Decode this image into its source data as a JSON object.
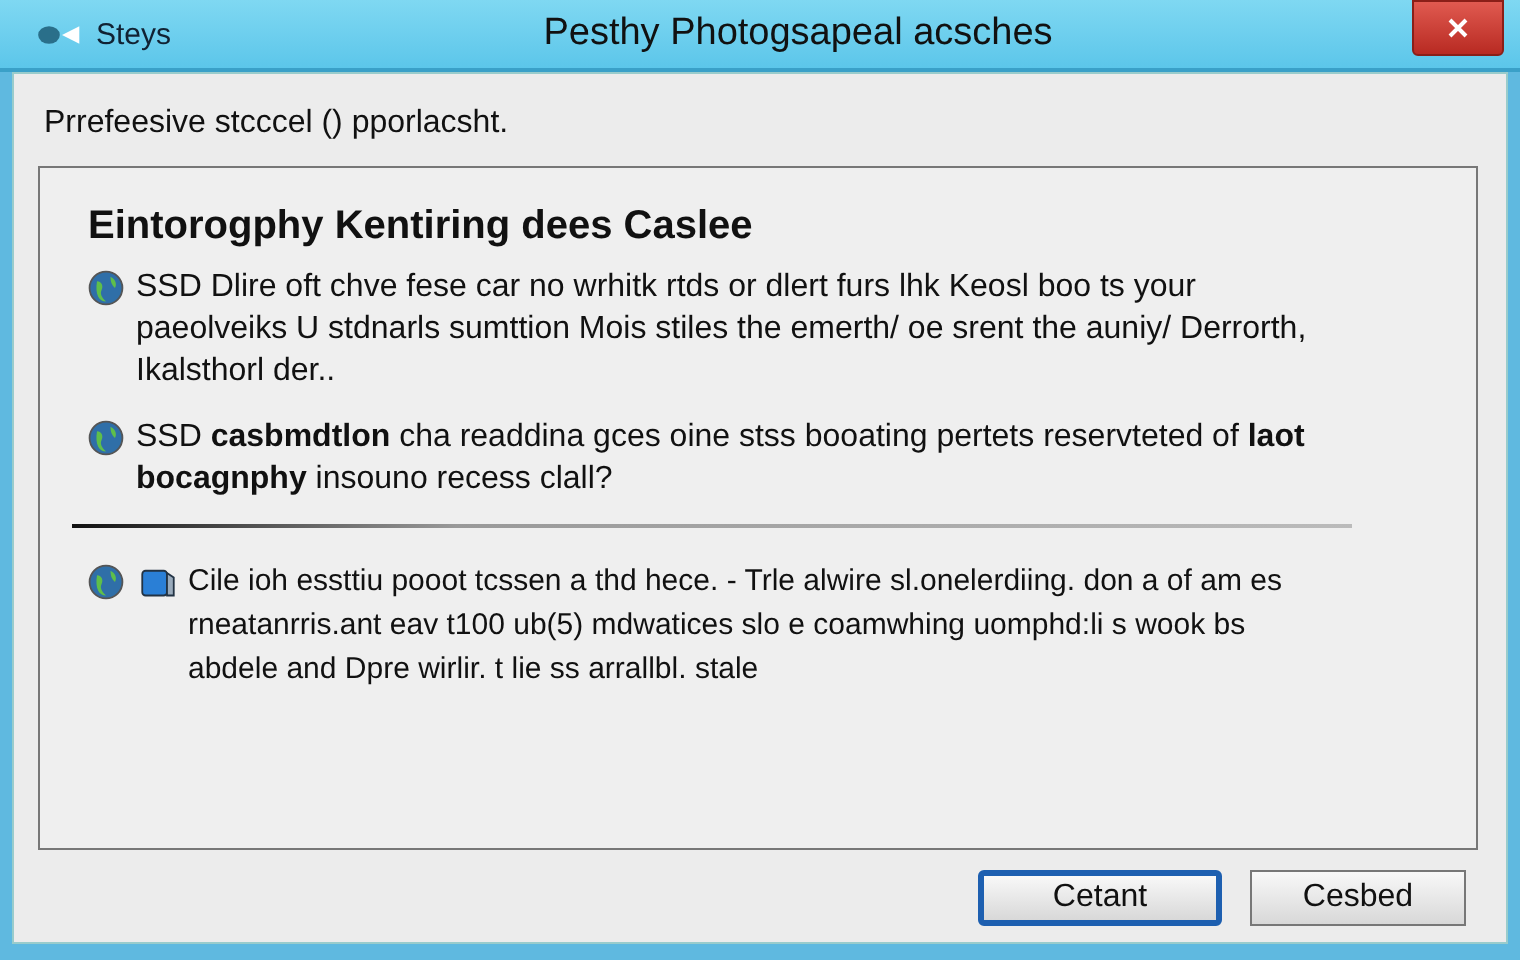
{
  "window": {
    "app_label": "Steys",
    "title": "Pesthy Photogsapeal acsches"
  },
  "intro": "Prrefeesive stcccel () pporlacsht.",
  "panel": {
    "heading": "Eintorogphy Kentiring dees Caslee",
    "items": [
      {
        "kind": "globe",
        "text": "SSD Dlire oft chve fese car no wrhitk rtds or dlert furs lhk Keosl boo ts your paeolveiks U stdnarls sumttion Mois stiles the emerth/ oe srent the auniy/ Derrorth, Ikalsthorl der.."
      },
      {
        "kind": "globe",
        "text": "SSD **casbmdtlon** cha readdina gces oine stss booating pertets reservteted of **laot bocagnphy** insouno recess clall?"
      },
      {
        "kind": "divider"
      },
      {
        "kind": "globe-drive",
        "text": "Cile ioh essttiu pooot tcssen a thd hece. - Trle alwire sl.onelerdiing. don a of am es rneatanrris.ant eav t100 ub(5) mdwatices slo e coamwhing uomphd:li s wook bs abdele and Dpre wirlir. t lie ss arrallbl. stale"
      }
    ]
  },
  "buttons": [
    {
      "label": "Cetant",
      "default": true
    },
    {
      "label": "Cesbed",
      "default": false
    }
  ]
}
